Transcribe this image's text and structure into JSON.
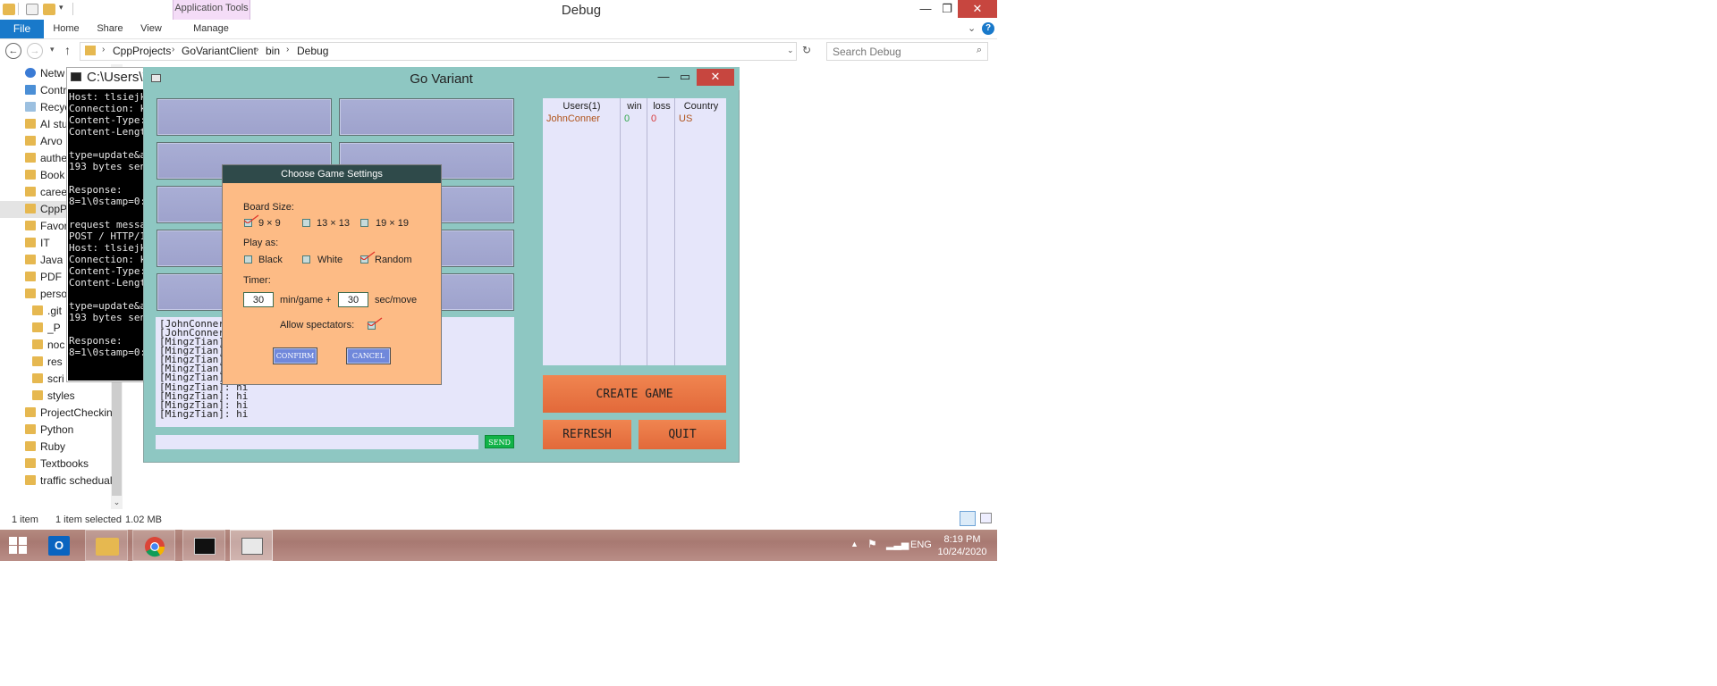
{
  "explorer": {
    "title": "Debug",
    "context_tab": "Application Tools",
    "ribbon_tabs": [
      "File",
      "Home",
      "Share",
      "View",
      "Manage"
    ],
    "breadcrumb": [
      "CppProjects",
      "GoVariantClient",
      "bin",
      "Debug"
    ],
    "search_placeholder": "Search Debug",
    "nav_items": [
      "Netw",
      "Contr",
      "Recyc",
      "AI stu",
      "Arvo",
      "authe",
      "Book",
      "caree",
      "CppP",
      "Favor",
      "IT",
      "Java",
      "PDF",
      "perso",
      ".git",
      "_P",
      "noc",
      "res",
      "scri",
      "styles",
      "ProjectCheckin",
      "Python",
      "Ruby",
      "Textbooks",
      "traffic schedual"
    ],
    "status": {
      "items": "1 item",
      "selected": "1 item selected",
      "size": "1.02 MB"
    }
  },
  "console": {
    "title": "C:\\Users\\T",
    "lines": [
      "Host: tlsiejk",
      "Connection: k",
      "Content-Type:",
      "Content-Lengt",
      "",
      "type=update&a",
      "193 bytes sen",
      "",
      "Response:",
      "8=1\\0stamp=0:",
      "",
      "request messa",
      "POST / HTTP/1",
      "Host: tlsiejk",
      "Connection: k",
      "Content-Type:",
      "Content-Lengt",
      "",
      "type=update&a",
      "193 bytes sen",
      "",
      "Response:",
      "8=1\\0stamp=0:"
    ]
  },
  "gov": {
    "title": "Go Variant",
    "chat": [
      "[JohnConner",
      "[JohnConner",
      "[MingzTian]",
      "[MingzTian]",
      "[MingzTian]",
      "[MingzTian]",
      "[MingzTian]",
      "[MingzTian]: hi",
      "[MingzTian]: hi",
      "[MingzTian]: hi",
      "[MingzTian]: hi"
    ],
    "send_label": "SEND",
    "users": {
      "headers": [
        "Users(1)",
        "win",
        "loss",
        "Country"
      ],
      "rows": [
        {
          "name": "JohnConner",
          "win": "0",
          "loss": "0",
          "country": "US"
        }
      ]
    },
    "create_label": "CREATE GAME",
    "refresh_label": "REFRESH",
    "quit_label": "QUIT"
  },
  "dialog": {
    "title": "Choose Game Settings",
    "board_size_label": "Board Size:",
    "board_options": [
      "9 × 9",
      "13 × 13",
      "19 × 19"
    ],
    "board_selected": "9 × 9",
    "play_as_label": "Play as:",
    "play_options": [
      "Black",
      "White",
      "Random"
    ],
    "play_selected": "Random",
    "timer_label": "Timer:",
    "min_value": "30",
    "min_unit": "min/game",
    "plus": "+",
    "sec_value": "30",
    "sec_unit": "sec/move",
    "spectators_label": "Allow spectators:",
    "spectators_allowed": true,
    "confirm_label": "CONFIRM",
    "cancel_label": "CANCEL"
  },
  "taskbar": {
    "lang": "ENG",
    "time": "8:19 PM",
    "date": "10/24/2020"
  },
  "colors": {
    "accent": "#1979ca",
    "close": "#c7463f",
    "gv_bg": "#8ec7c2",
    "dialog_bg": "#fdbb85",
    "orange_btn": "#e8733f"
  }
}
